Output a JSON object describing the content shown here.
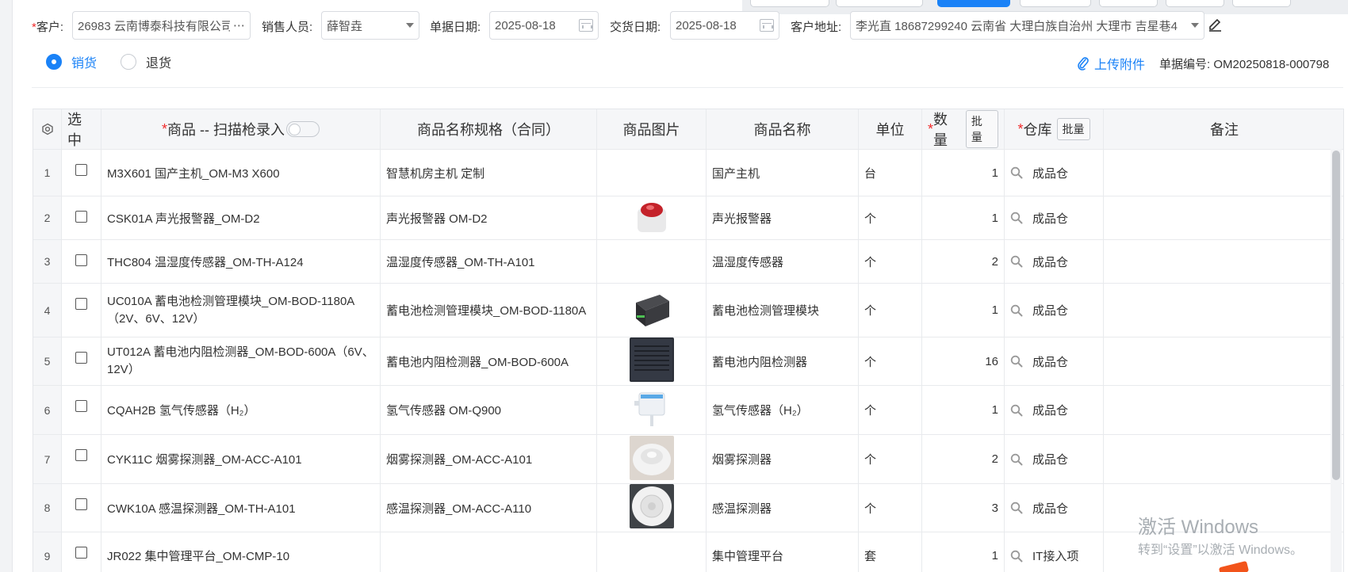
{
  "form": {
    "customer": {
      "label": "客户:",
      "required": "*",
      "value": "26983 云南博泰科技有限公司"
    },
    "salesperson": {
      "label": "销售人员:",
      "value": "薛智垚"
    },
    "doc_date": {
      "label": "单据日期:",
      "value": "2025-08-18"
    },
    "delivery_date": {
      "label": "交货日期:",
      "value": "2025-08-18"
    },
    "address": {
      "label": "客户地址:",
      "value": "李光直 18687299240 云南省 大理白族自治州 大理市 吉星巷4"
    }
  },
  "radios": [
    {
      "label": "销货",
      "selected": true
    },
    {
      "label": "退货",
      "selected": false
    }
  ],
  "upload_label": "上传附件",
  "doc_number": "单据编号: OM20250818-000798",
  "table": {
    "headers": {
      "select": "选中",
      "product_req": "*",
      "product": "商品 -- 扫描枪录入",
      "spec": "商品名称规格（合同）",
      "image": "商品图片",
      "name": "商品名称",
      "unit": "单位",
      "qty_req": "*",
      "qty": "数量",
      "qty_batch": "批量",
      "wh_req": "*",
      "warehouse": "仓库",
      "wh_batch": "批量",
      "remark": "备注"
    },
    "rows": [
      {
        "no": "1",
        "product": "M3X601 国产主机_OM-M3 X600",
        "spec": "智慧机房主机 定制",
        "image": "",
        "name": "国产主机",
        "unit": "台",
        "qty": "1",
        "warehouse": "成品仓"
      },
      {
        "no": "2",
        "product": "CSK01A 声光报警器_OM-D2",
        "spec": "声光报警器 OM-D2",
        "image": "alarm-photo",
        "name": "声光报警器",
        "unit": "个",
        "qty": "1",
        "warehouse": "成品仓"
      },
      {
        "no": "3",
        "product": "THC804 温湿度传感器_OM-TH-A124",
        "spec": "温湿度传感器_OM-TH-A101",
        "image": "",
        "name": "温湿度传感器",
        "unit": "个",
        "qty": "2",
        "warehouse": "成品仓"
      },
      {
        "no": "4",
        "product": "UC010A 蓄电池检测管理模块_OM-BOD-1180A（2V、6V、12V）",
        "spec": "蓄电池检测管理模块_OM-BOD-1180A",
        "image": "module-photo",
        "name": "蓄电池检测管理模块",
        "unit": "个",
        "qty": "1",
        "warehouse": "成品仓"
      },
      {
        "no": "5",
        "product": "UT012A 蓄电池内阻检测器_OM-BOD-600A（6V、12V）",
        "spec": "蓄电池内阻检测器_OM-BOD-600A",
        "image": "tester-photo",
        "name": "蓄电池内阻检测器",
        "unit": "个",
        "qty": "16",
        "warehouse": "成品仓"
      },
      {
        "no": "6",
        "product": "CQAH2B 氢气传感器（H₂）",
        "spec": "氢气传感器 OM-Q900",
        "image": "sensor-photo",
        "name": "氢气传感器（H₂）",
        "unit": "个",
        "qty": "1",
        "warehouse": "成品仓"
      },
      {
        "no": "7",
        "product": "CYK11C 烟雾探测器_OM-ACC-A101",
        "spec": "烟雾探测器_OM-ACC-A101",
        "image": "smoke-photo",
        "name": "烟雾探测器",
        "unit": "个",
        "qty": "2",
        "warehouse": "成品仓"
      },
      {
        "no": "8",
        "product": "CWK10A 感温探测器_OM-TH-A101",
        "spec": "感温探测器_OM-ACC-A110",
        "image": "heat-photo",
        "name": "感温探测器",
        "unit": "个",
        "qty": "3",
        "warehouse": "成品仓"
      },
      {
        "no": "9",
        "product": "JR022 集中管理平台_OM-CMP-10",
        "spec": "",
        "image": "",
        "name": "集中管理平台",
        "unit": "套",
        "qty": "1",
        "warehouse": "IT接入项"
      }
    ]
  },
  "watermark": {
    "line1": "激活 Windows",
    "line2": "转到“设置”以激活 Windows。"
  },
  "colors": {
    "accent": "#1a82f7",
    "required": "#f02b2b"
  }
}
